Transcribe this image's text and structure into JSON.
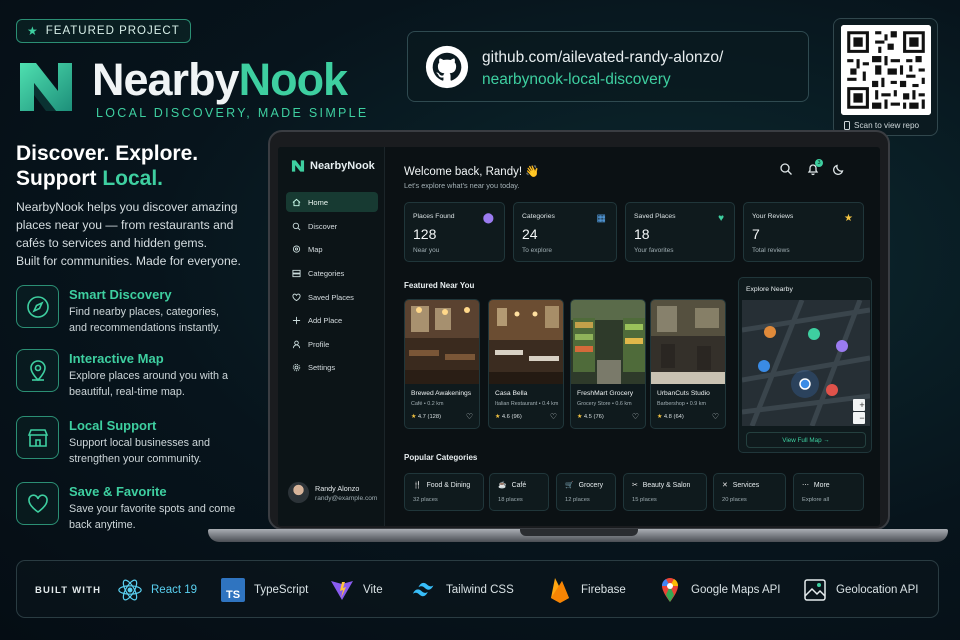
{
  "badge": {
    "label": "FEATURED PROJECT",
    "icon": "star-icon"
  },
  "brand": {
    "name_part1": "Nearby",
    "name_part2": "Nook",
    "tagline": "LOCAL DISCOVERY, MADE SIMPLE",
    "accent_color": "#3ecfa0"
  },
  "headline": {
    "line1": "Discover. Explore.",
    "line2_prefix": "Support ",
    "line2_accent": "Local."
  },
  "intro": {
    "text": "NearbyNook helps you discover amazing places near you — from restaurants and cafés to services and hidden gems.",
    "text2": "Built for communities. Made for everyone."
  },
  "features": [
    {
      "title": "Smart Discovery",
      "desc": "Find nearby places, categories, and recommendations instantly.",
      "icon": "compass-icon"
    },
    {
      "title": "Interactive Map",
      "desc": "Explore places around you with a beautiful, real-time map.",
      "icon": "map-pin-icon"
    },
    {
      "title": "Local Support",
      "desc": "Support local businesses and strengthen your community.",
      "icon": "storefront-icon"
    },
    {
      "title": "Save & Favorite",
      "desc": "Save your favorite spots and come back anytime.",
      "icon": "heart-icon"
    }
  ],
  "repo": {
    "line1": "github.com/ailevated-randy-alonzo/",
    "line2": "nearbynook-local-discovery",
    "icon": "github-icon"
  },
  "qr": {
    "caption": "Scan to view repo",
    "icon": "phone-icon"
  },
  "app": {
    "logo": "NearbyNook",
    "nav": [
      {
        "label": "Home",
        "icon": "home-icon",
        "active": true
      },
      {
        "label": "Discover",
        "icon": "search-icon"
      },
      {
        "label": "Map",
        "icon": "map-icon"
      },
      {
        "label": "Categories",
        "icon": "categories-icon"
      },
      {
        "label": "Saved Places",
        "icon": "heart-icon"
      },
      {
        "label": "Add Place",
        "icon": "plus-icon"
      },
      {
        "label": "Profile",
        "icon": "user-icon"
      },
      {
        "label": "Settings",
        "icon": "gear-icon"
      }
    ],
    "user": {
      "name": "Randy Alonzo",
      "email": "randy@example.com"
    },
    "welcome": "Welcome back, Randy! 👋",
    "subtitle": "Let's explore what's near you today.",
    "notification_count": "3",
    "stats": [
      {
        "label": "Places Found",
        "value": "128",
        "sub": "Near you",
        "icon": "pin-icon",
        "color": "#9b7bf0"
      },
      {
        "label": "Categories",
        "value": "24",
        "sub": "To explore",
        "icon": "grid-icon",
        "color": "#5aa8f0"
      },
      {
        "label": "Saved Places",
        "value": "18",
        "sub": "Your favorites",
        "icon": "heart-icon",
        "color": "#3ecfa0"
      },
      {
        "label": "Your Reviews",
        "value": "7",
        "sub": "Total reviews",
        "icon": "star-icon",
        "color": "#f5c542"
      }
    ],
    "featured_title": "Featured Near You",
    "places": [
      {
        "name": "Brewed Awakenings",
        "sub": "Café • 0.2 km",
        "rating": "4.7",
        "count": "(128)"
      },
      {
        "name": "Casa Bella",
        "sub": "Italian Restaurant • 0.4 km",
        "rating": "4.6",
        "count": "(96)"
      },
      {
        "name": "FreshMart Grocery",
        "sub": "Grocery Store • 0.6 km",
        "rating": "4.5",
        "count": "(76)"
      },
      {
        "name": "UrbanCuts Studio",
        "sub": "Barbershop • 0.9 km",
        "rating": "4.8",
        "count": "(64)"
      }
    ],
    "map": {
      "title": "Explore Nearby",
      "button": "View Full Map →",
      "zoom_in": "+",
      "zoom_out": "−"
    },
    "categories_title": "Popular Categories",
    "categories": [
      {
        "label": "Food & Dining",
        "count": "32 places",
        "icon": "fork-knife-icon"
      },
      {
        "label": "Café",
        "count": "18 places",
        "icon": "coffee-icon"
      },
      {
        "label": "Grocery",
        "count": "12 places",
        "icon": "cart-icon"
      },
      {
        "label": "Beauty & Salon",
        "count": "15 places",
        "icon": "scissors-icon"
      },
      {
        "label": "Services",
        "count": "20 places",
        "icon": "tools-icon"
      },
      {
        "label": "More",
        "count": "Explore all",
        "icon": "more-icon"
      }
    ]
  },
  "built_with": {
    "label": "BUILT WITH",
    "items": [
      {
        "name": "React 19",
        "icon": "react-icon"
      },
      {
        "name": "TypeScript",
        "icon": "typescript-icon"
      },
      {
        "name": "Vite",
        "icon": "vite-icon"
      },
      {
        "name": "Tailwind CSS",
        "icon": "tailwind-icon"
      },
      {
        "name": "Firebase",
        "icon": "firebase-icon"
      },
      {
        "name": "Google Maps API",
        "icon": "google-maps-icon"
      },
      {
        "name": "Geolocation API",
        "icon": "geolocation-icon"
      }
    ]
  }
}
